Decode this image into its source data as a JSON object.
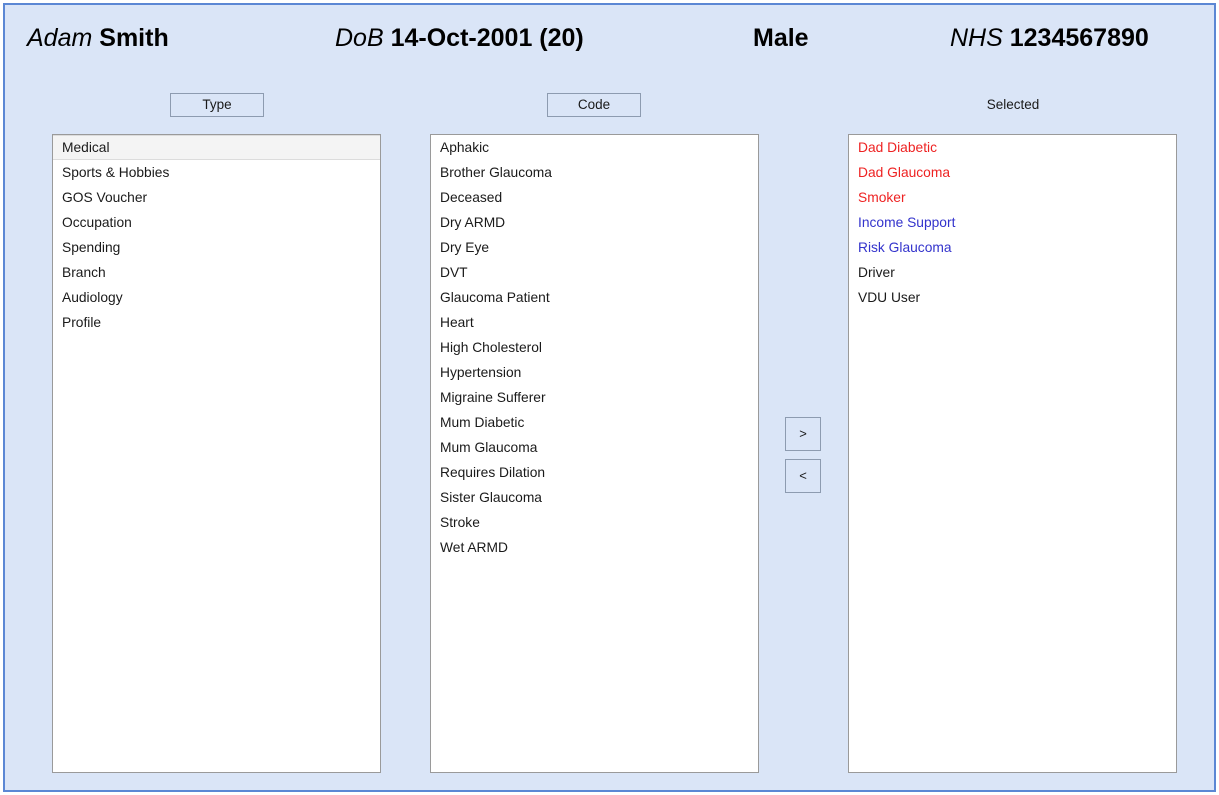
{
  "header": {
    "name_label": "Adam",
    "name_value": "Smith",
    "dob_label": "DoB",
    "dob_value": "14-Oct-2001 (20)",
    "gender_value": "Male",
    "nhs_label": "NHS",
    "nhs_value": "1234567890"
  },
  "columns": {
    "type_button": "Type",
    "code_button": "Code",
    "selected_label": "Selected"
  },
  "transfer": {
    "add_label": ">",
    "remove_label": "<"
  },
  "type_list": {
    "items": [
      {
        "label": "Medical",
        "selected": true
      },
      {
        "label": "Sports & Hobbies",
        "selected": false
      },
      {
        "label": "GOS Voucher",
        "selected": false
      },
      {
        "label": "Occupation",
        "selected": false
      },
      {
        "label": "Spending",
        "selected": false
      },
      {
        "label": "Branch",
        "selected": false
      },
      {
        "label": "Audiology",
        "selected": false
      },
      {
        "label": "Profile",
        "selected": false
      }
    ]
  },
  "code_list": {
    "items": [
      {
        "label": "Aphakic"
      },
      {
        "label": "Brother Glaucoma"
      },
      {
        "label": "Deceased"
      },
      {
        "label": "Dry ARMD"
      },
      {
        "label": "Dry Eye"
      },
      {
        "label": "DVT"
      },
      {
        "label": "Glaucoma Patient"
      },
      {
        "label": "Heart"
      },
      {
        "label": "High Cholesterol"
      },
      {
        "label": "Hypertension"
      },
      {
        "label": "Migraine Sufferer"
      },
      {
        "label": "Mum Diabetic"
      },
      {
        "label": "Mum Glaucoma"
      },
      {
        "label": "Requires Dilation"
      },
      {
        "label": "Sister Glaucoma"
      },
      {
        "label": "Stroke"
      },
      {
        "label": "Wet ARMD"
      }
    ]
  },
  "selected_list": {
    "items": [
      {
        "label": "Dad Diabetic",
        "color": "red"
      },
      {
        "label": "Dad Glaucoma",
        "color": "red"
      },
      {
        "label": "Smoker",
        "color": "red"
      },
      {
        "label": "Income Support",
        "color": "blue"
      },
      {
        "label": "Risk Glaucoma",
        "color": "blue"
      },
      {
        "label": "Driver",
        "color": "black"
      },
      {
        "label": "VDU User",
        "color": "black"
      }
    ]
  },
  "colors": {
    "panel_background": "#dae5f7",
    "panel_border": "#5b87d4",
    "list_background": "#ffffff",
    "list_border": "#9a9a9a",
    "selection_band": "#f4f4f4",
    "risk_red": "#ee2222",
    "info_blue": "#3333cc",
    "text_black": "#1a1a1a"
  }
}
